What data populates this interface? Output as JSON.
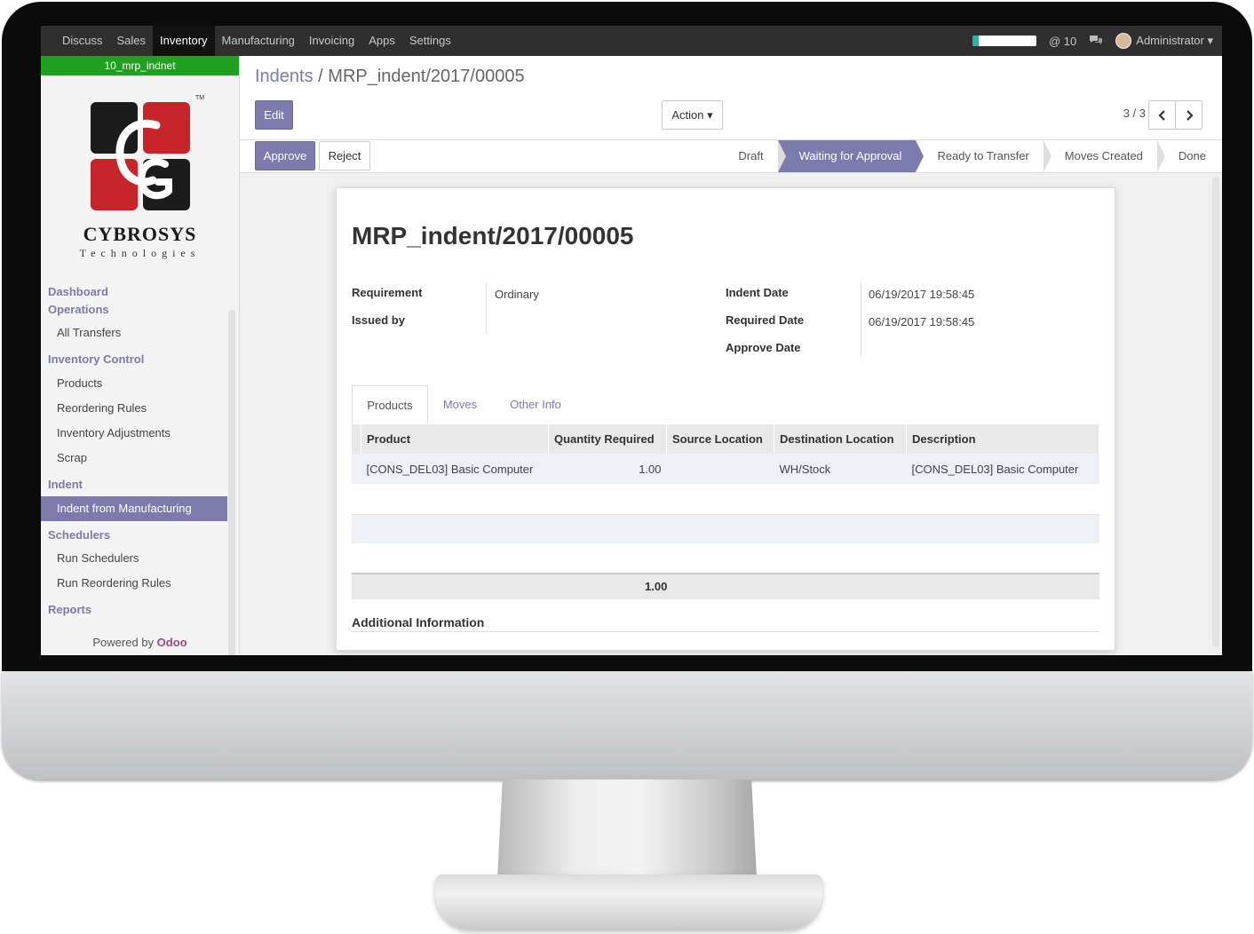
{
  "topbar": {
    "menu": [
      "Discuss",
      "Sales",
      "Inventory",
      "Manufacturing",
      "Invoicing",
      "Apps",
      "Settings"
    ],
    "active_menu": "Inventory",
    "notifications": "@ 10",
    "user": "Administrator ▾",
    "progress_fraction": 0.1
  },
  "sidebar": {
    "database": "10_mrp_indnet",
    "logo_name": "CYBROSYS",
    "logo_sub": "Technologies",
    "logo_tm": "TM",
    "sections": {
      "dashboard": "Dashboard",
      "operations": "Operations",
      "all_transfers": "All Transfers",
      "inventory_control": "Inventory Control",
      "products": "Products",
      "reordering_rules": "Reordering Rules",
      "inventory_adjustments": "Inventory Adjustments",
      "scrap": "Scrap",
      "indent": "Indent",
      "indent_from_manufacturing": "Indent from Manufacturing",
      "schedulers": "Schedulers",
      "run_schedulers": "Run Schedulers",
      "run_reordering_rules": "Run Reordering Rules",
      "reports": "Reports"
    },
    "powered_by": "Powered by",
    "powered_brand": "Odoo"
  },
  "control_panel": {
    "breadcrumb_parent": "Indents",
    "breadcrumb_sep": " / ",
    "breadcrumb_current": "MRP_indent/2017/00005",
    "edit_label": "Edit",
    "action_label": "Action ▾",
    "pager": "3 / 3"
  },
  "statusbar": {
    "approve_label": "Approve",
    "reject_label": "Reject",
    "stages": [
      "Draft",
      "Waiting for Approval",
      "Ready to Transfer",
      "Moves Created",
      "Done"
    ],
    "current_stage": "Waiting for Approval"
  },
  "form": {
    "title": "MRP_indent/2017/00005",
    "requirement_label": "Requirement",
    "requirement_value": "Ordinary",
    "issued_by_label": "Issued by",
    "indent_date_label": "Indent Date",
    "indent_date_value": "06/19/2017 19:58:45",
    "required_date_label": "Required Date",
    "required_date_value": "06/19/2017 19:58:45",
    "approve_date_label": "Approve Date",
    "tabs": [
      "Products",
      "Moves",
      "Other Info"
    ],
    "columns": [
      "Product",
      "Quantity Required",
      "Source Location",
      "Destination Location",
      "Description"
    ],
    "rows": [
      {
        "product": "[CONS_DEL03] Basic Computer",
        "qty": "1.00",
        "source": "",
        "dest": "WH/Stock",
        "description": "[CONS_DEL03] Basic Computer"
      }
    ],
    "total_qty": "1.00",
    "additional_info": "Additional Information"
  },
  "colors": {
    "accent": "#7c7bad",
    "topbar": "#2f2f2f",
    "db_bar": "#1fa11f",
    "logo_red": "#c8252b",
    "logo_black": "#1c1c1c",
    "odoo_brand": "#a24689"
  }
}
